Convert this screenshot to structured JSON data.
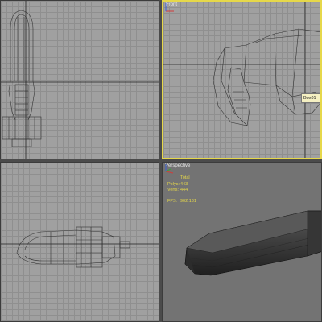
{
  "viewports": {
    "top": {
      "label": ""
    },
    "front": {
      "label": "Front",
      "tooltip": "Box01"
    },
    "left": {
      "label": ""
    },
    "perspective": {
      "label": "Perspective",
      "stats": {
        "header": "Total",
        "polys_label": "Polys:",
        "polys_value": "443",
        "verts_label": "Verts:",
        "verts_value": "444",
        "fps_label": "FPS:",
        "fps_value": "902.131"
      }
    }
  },
  "colors": {
    "viewport_bg": "#a0a0a0",
    "grid_line": "#8f8f8f",
    "active_border": "#e6d84a",
    "wire": "#333333",
    "perspective_bg": "#737373",
    "axis_x": "#d23b3b",
    "axis_y": "#3aa13a",
    "axis_z": "#3a5fd2"
  },
  "icons": [
    "axis-gizmo-icon"
  ]
}
